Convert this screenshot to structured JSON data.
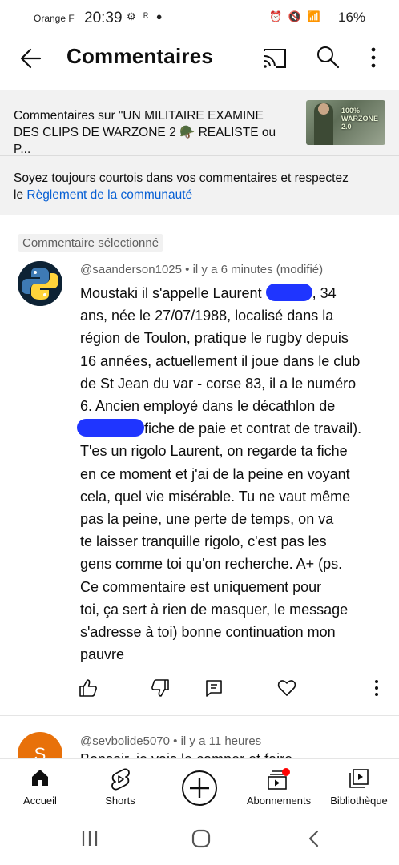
{
  "status": {
    "carrier": "Orange F",
    "time": "20:39",
    "battery": "16%"
  },
  "app_bar": {
    "title": "Commentaires"
  },
  "video": {
    "title_line1": "Commentaires sur \"UN MILITAIRE EXAMINE",
    "title_line2": "DES CLIPS DE WARZONE 2 🪖 REALISTE ou P...",
    "thumb_caption_line1": "100%",
    "thumb_caption_line2": "WARZONE 2.0",
    "guideline_line1": "Soyez toujours courtois dans vos commentaires et respectez",
    "guideline_prefix": "le ",
    "guideline_link": "Règlement de la communauté"
  },
  "selected_badge": "Commentaire sélectionné",
  "comment": {
    "author": "@saanderson1025",
    "meta": " • il y a 6 minutes (modifié)",
    "lines": [
      "Moustaki il s'appelle Laurent",
      ", 34",
      "ans, née le 27/07/1988, localisé dans la",
      "région de Toulon, pratique le rugby depuis",
      "16 années, actuellement il joue dans le club",
      "de St Jean du var - corse 83, il a le numéro",
      "6. Ancien employé dans le décathlon de",
      "fiche de paie et contrat de travail).",
      "T'es un rigolo Laurent, on regarde ta fiche",
      "en ce moment et j'ai de la peine en voyant",
      "cela, quel vie misérable. Tu ne vaut même",
      "pas la peine, une perte de temps, on va",
      "te laisser tranquille rigolo, c'est pas les",
      "gens comme toi qu'on recherche. A+ (ps.",
      "Ce commentaire est uniquement pour",
      "toi, ça sert à rien de masquer, le message",
      "s'adresse à toi) bonne continuation mon",
      "pauvre"
    ]
  },
  "next_comment": {
    "avatar_letter": "S",
    "author": "@sevbolide5070",
    "meta": " • il y a 11 heures",
    "peek": "Bonsoir, je vais le camper et faire"
  },
  "bottom_nav": {
    "items": [
      {
        "label": "Accueil",
        "icon": "home-icon"
      },
      {
        "label": "Shorts",
        "icon": "shorts-icon"
      },
      {
        "label": "",
        "icon": "create-icon"
      },
      {
        "label": "Abonnements",
        "icon": "subscriptions-icon"
      },
      {
        "label": "Bibliothèque",
        "icon": "library-icon"
      }
    ]
  },
  "colors": {
    "link": "#065fd4",
    "redaction": "#1f35ff",
    "notification_dot": "#ff0000",
    "avatar_s": "#e8710a"
  }
}
